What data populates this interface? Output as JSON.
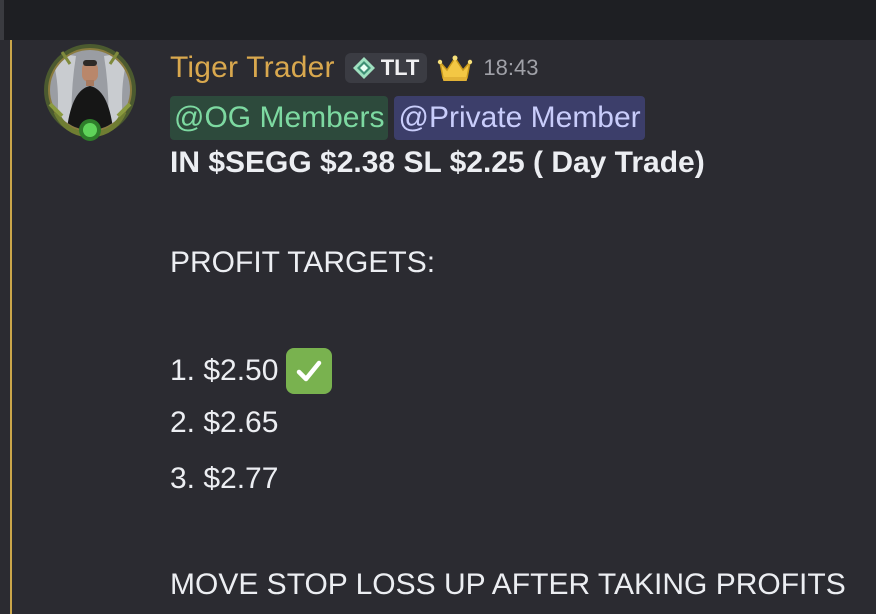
{
  "message": {
    "author": {
      "name": "Tiger Trader",
      "tag": "TLT",
      "tag_icon": "diamond-icon",
      "role_icon": "crown-icon",
      "avatar_icon": "avatar"
    },
    "timestamp": "18:43",
    "mentions": [
      "@OG Members",
      "@Private Member"
    ],
    "content": {
      "trade_line": "IN $SEGG $2.38 SL $2.25 ( Day Trade)",
      "targets_heading": "PROFIT TARGETS:",
      "targets": [
        {
          "text": "1. $2.50",
          "hit": true
        },
        {
          "text": "2. $2.65",
          "hit": false
        },
        {
          "text": "3. $2.77",
          "hit": false
        }
      ],
      "stop_loss_note": "MOVE STOP LOSS UP AFTER TAKING PROFITS"
    }
  },
  "colors": {
    "background": "#2b2b31",
    "username": "#d9a84e",
    "mention_og_bg": "#2d4a3c",
    "mention_og_text": "#7dd9a1",
    "mention_private_bg": "#3c3e6a",
    "mention_private_text": "#c9cdfb",
    "check_green": "#79b24f",
    "accent_bar": "#caa64a"
  }
}
